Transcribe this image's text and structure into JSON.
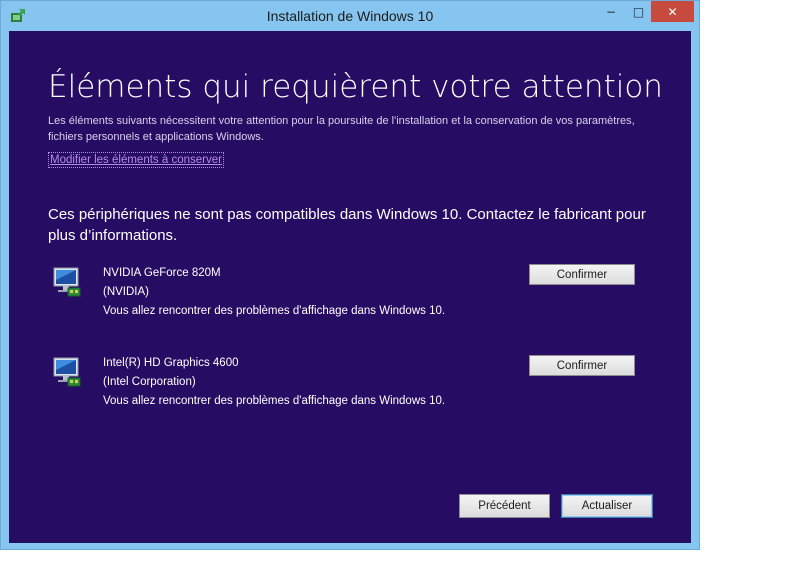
{
  "window": {
    "title": "Installation de Windows 10",
    "controls": {
      "minimize": "−",
      "maximize": "□",
      "close": "✕"
    }
  },
  "main": {
    "heading": "Éléments qui requièrent votre attention",
    "description": "Les éléments suivants nécessitent votre attention pour la poursuite de l'installation et la conservation de vos paramètres, fichiers personnels et applications Windows.",
    "modify_link": "Modifier les éléments à conserver",
    "subheading": "Ces périphériques ne sont pas compatibles dans Windows 10. Contactez le fabricant pour plus d’informations.",
    "devices": [
      {
        "name": "NVIDIA GeForce 820M",
        "vendor": "(NVIDIA)",
        "issue": "Vous allez rencontrer des problèmes d'affichage dans Windows 10.",
        "button": "Confirmer",
        "icon": "display-adapter-icon"
      },
      {
        "name": "Intel(R) HD Graphics 4600",
        "vendor": "(Intel Corporation)",
        "issue": "Vous allez rencontrer des problèmes d'affichage dans Windows 10.",
        "button": "Confirmer",
        "icon": "display-adapter-icon"
      }
    ]
  },
  "footer": {
    "back_label": "Précédent",
    "refresh_label": "Actualiser"
  },
  "colors": {
    "background": "#270c63",
    "frame": "#86c5f0",
    "close": "#c74a3f",
    "link": "#b28ce8"
  }
}
